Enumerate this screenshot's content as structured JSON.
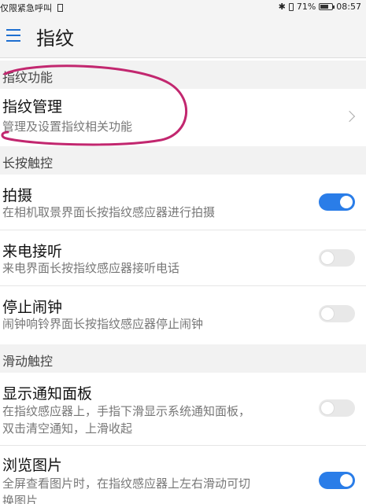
{
  "status_bar": {
    "left_text": "仅限紧急呼叫",
    "battery": "71%",
    "battery_level": 0.71,
    "time": "08:57",
    "icons": [
      "sim-icon",
      "bluetooth-icon",
      "vibrate-icon",
      "battery-icon"
    ]
  },
  "app_bar": {
    "title": "指纹",
    "menu_icon": "hamburger-menu-icon"
  },
  "sections": [
    {
      "label": "指纹功能",
      "items": [
        {
          "title": "指纹管理",
          "subtitle": "管理及设置指纹相关功能",
          "control": "chevron"
        }
      ]
    },
    {
      "label": "长按触控",
      "items": [
        {
          "title": "拍摄",
          "subtitle": "在相机取景界面长按指纹感应器进行拍摄",
          "control": "toggle",
          "on": true
        },
        {
          "title": "来电接听",
          "subtitle": "来电界面长按指纹感应器接听电话",
          "control": "toggle",
          "on": false
        },
        {
          "title": "停止闹钟",
          "subtitle": "闹钟响铃界面长按指纹感应器停止闹钟",
          "control": "toggle",
          "on": false
        }
      ]
    },
    {
      "label": "滑动触控",
      "items": [
        {
          "title": "显示通知面板",
          "subtitle_lines": [
            "在指纹感应器上，手指下滑显示系统通知面板，",
            "双击清空通知，上滑收起"
          ],
          "control": "toggle",
          "on": false
        },
        {
          "title": "浏览图片",
          "subtitle_lines": [
            "全屏查看图片时，在指纹感应器上左右滑动可切",
            "换图片"
          ],
          "control": "toggle",
          "on": true
        }
      ]
    }
  ],
  "colors": {
    "accent": "#2a7de8",
    "annotation": "#c2276f",
    "section_bg": "#f2f2f2"
  }
}
